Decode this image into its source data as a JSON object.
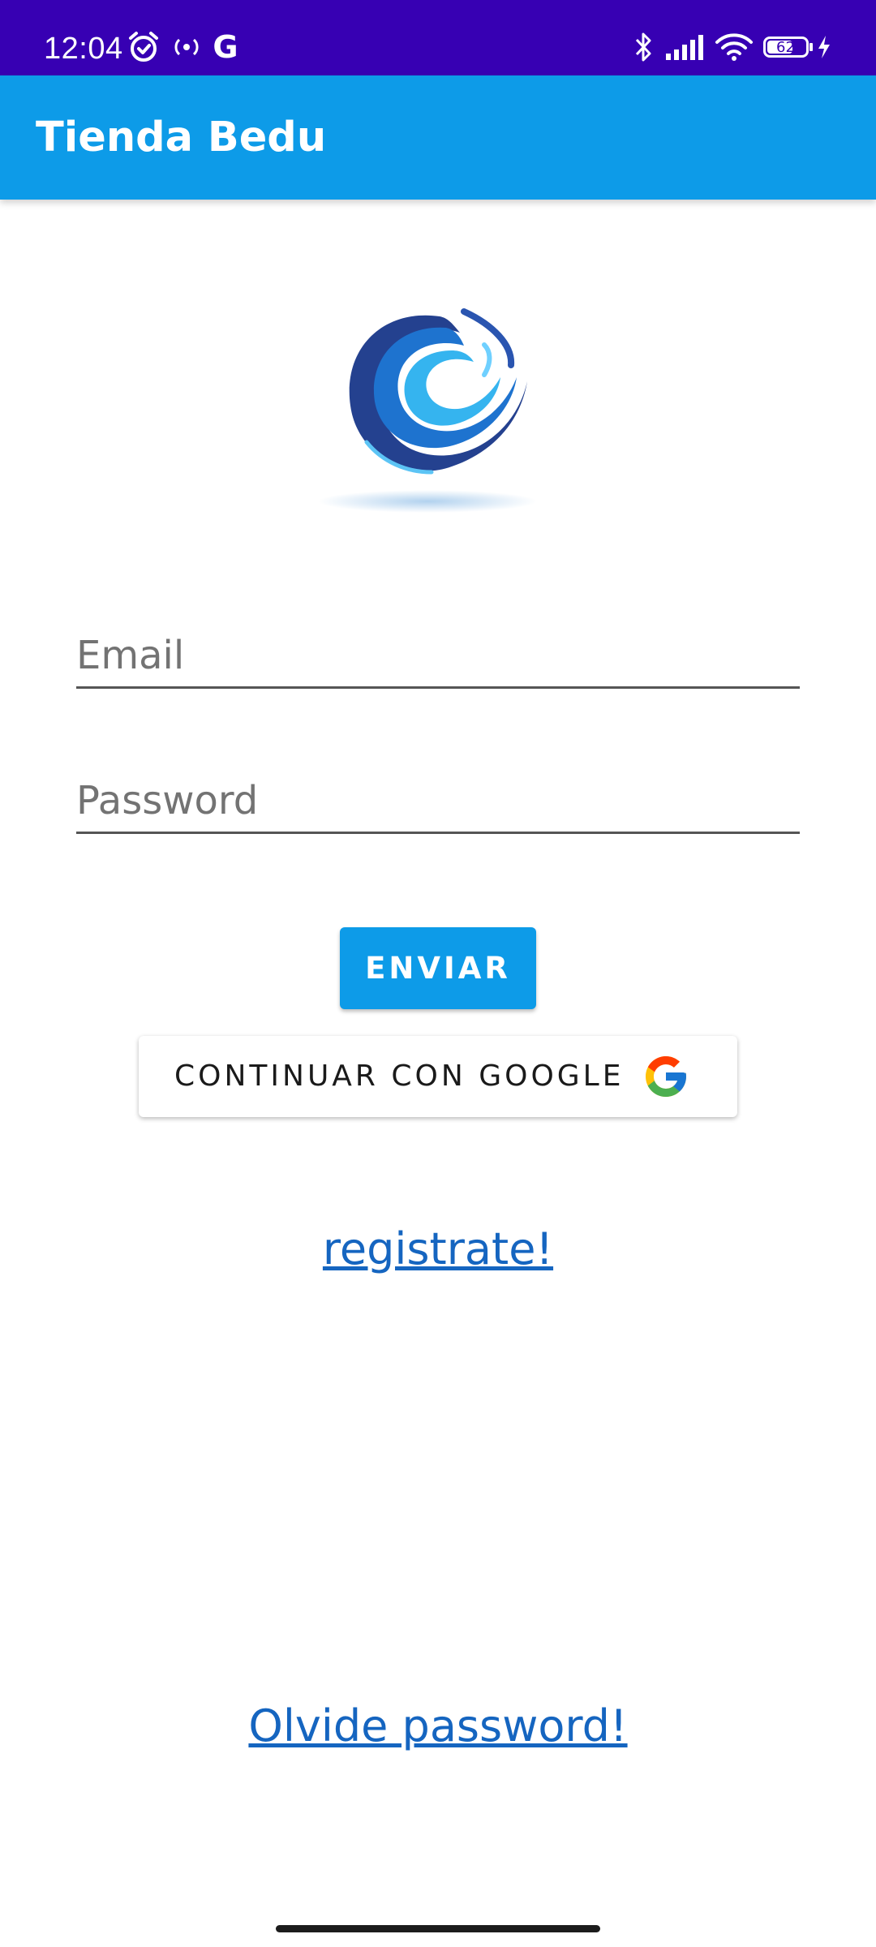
{
  "status_bar": {
    "time": "12:04",
    "g_label": "G",
    "battery_level": "62",
    "icons": [
      "alarm-icon",
      "hotspot-icon",
      "google-icon",
      "bluetooth-icon",
      "signal-icon",
      "wifi-icon",
      "battery-icon",
      "charging-icon"
    ],
    "background": "#3700b3"
  },
  "app_bar": {
    "title": "Tienda Bedu",
    "background": "#0d9be8"
  },
  "logo": {
    "icon": "wave-logo-icon"
  },
  "form": {
    "email_placeholder": "Email",
    "email_value": "",
    "password_placeholder": "Password",
    "password_value": "",
    "submit_label": "ENVIAR",
    "google_label": "CONTINUAR CON GOOGLE",
    "accent_color": "#0d9be8"
  },
  "links": {
    "register": "registrate!",
    "forgot_password": "Olvide password!",
    "link_color": "#1565c0"
  }
}
